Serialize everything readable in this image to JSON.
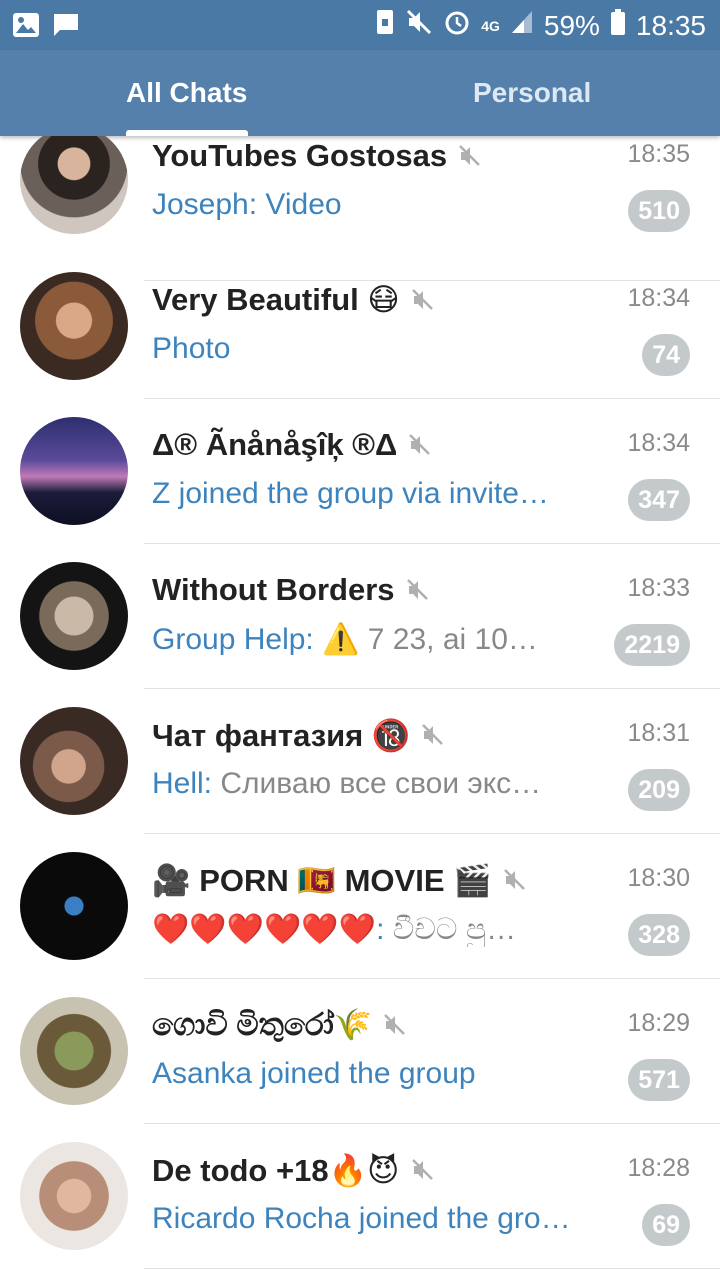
{
  "status_bar": {
    "battery": "59%",
    "time": "18:35",
    "network": "4G"
  },
  "tabs": [
    {
      "label": "All Chats",
      "active": true
    },
    {
      "label": "Personal",
      "active": false
    }
  ],
  "chats": [
    {
      "title": "YouTubes Gostosas",
      "time": "18:35",
      "sender": "Joseph: Video",
      "message": "",
      "unread": "510",
      "muted": true
    },
    {
      "title": "Very Beautiful 😷",
      "time": "18:34",
      "sender": "Photo",
      "message": "",
      "unread": "74",
      "muted": true
    },
    {
      "title": "Δ® Ãnånåşîķ ®Δ",
      "time": "18:34",
      "sender": "Z joined the group via invite…",
      "message": "",
      "unread": "347",
      "muted": true
    },
    {
      "title": "Without Borders",
      "time": "18:33",
      "sender": "Group Help: ",
      "message": "⚠️ 7 23, ai 10…",
      "unread": "2219",
      "muted": true
    },
    {
      "title": "Чат фантазия 🔞",
      "time": "18:31",
      "sender": "Hell: ",
      "message": "Сливаю все свои экс…",
      "unread": "209",
      "muted": true
    },
    {
      "title": "🎥 PORN 🇱🇰 MOVIE 🎬",
      "time": "18:30",
      "sender": "❤️❤️❤️❤️❤️❤️: ",
      "message": "වීචට පු…",
      "unread": "328",
      "muted": true
    },
    {
      "title": "ගොවි මිතුරෝ🌾",
      "time": "18:29",
      "sender": "Asanka joined the group",
      "message": "",
      "unread": "571",
      "muted": true
    },
    {
      "title": "De todo +18🔥😈",
      "time": "18:28",
      "sender": "Ricardo Rocha joined the gro…",
      "message": "",
      "unread": "69",
      "muted": true
    }
  ],
  "colors": {
    "header": "#5580ab",
    "status_bar": "#4a79a5",
    "preview_blue": "#3d83bd",
    "badge": "#c4c9cc"
  }
}
